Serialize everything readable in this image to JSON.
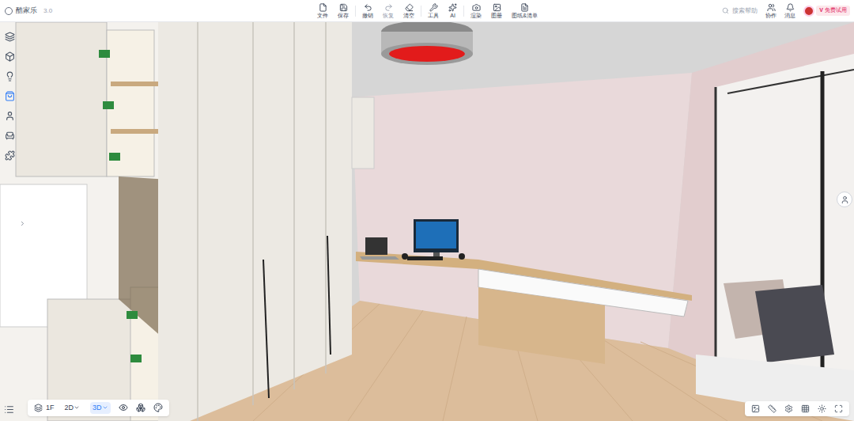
{
  "app": {
    "logo": "酷家乐",
    "version": "3.0"
  },
  "toolbar": [
    {
      "label": "文件",
      "disabled": false
    },
    {
      "label": "保存",
      "disabled": false
    },
    {
      "label": "撤销",
      "disabled": false
    },
    {
      "label": "恢复",
      "disabled": true
    },
    {
      "label": "清空",
      "disabled": false
    },
    {
      "label": "工具",
      "disabled": false
    },
    {
      "label": "AI",
      "disabled": false
    },
    {
      "label": "渲染",
      "disabled": false
    },
    {
      "label": "图册",
      "disabled": false
    },
    {
      "label": "图纸&清单",
      "disabled": false
    }
  ],
  "search": {
    "placeholder": "搜索帮助"
  },
  "user_menu": [
    {
      "label": "协作"
    },
    {
      "label": "消息"
    }
  ],
  "trial_badge": {
    "mark": "V",
    "label": "免费试用"
  },
  "sidebar": [
    {
      "selected": false
    },
    {
      "selected": false
    },
    {
      "selected": false
    },
    {
      "selected": true
    },
    {
      "selected": false
    },
    {
      "selected": false
    },
    {
      "selected": false
    }
  ],
  "floor_selector": "1F",
  "view_modes": [
    {
      "label": "2D",
      "selected": false
    },
    {
      "label": "3D",
      "selected": true
    }
  ]
}
